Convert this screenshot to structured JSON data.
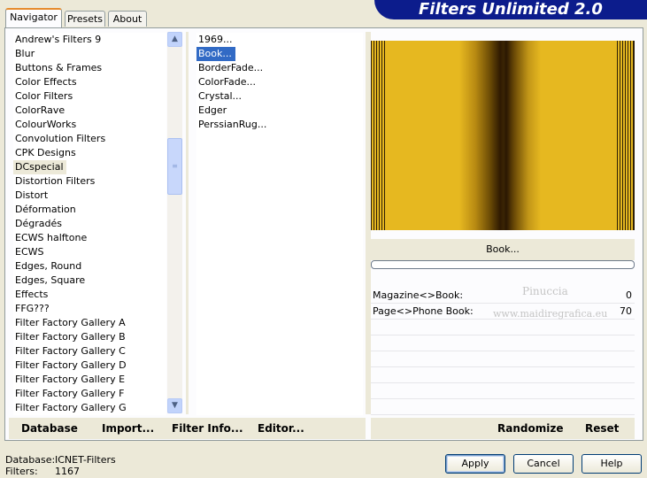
{
  "tabs": [
    {
      "label": "Navigator",
      "active": true
    },
    {
      "label": "Presets",
      "active": false
    },
    {
      "label": "About",
      "active": false
    }
  ],
  "title": "Filters Unlimited 2.0",
  "categories": [
    "Andrew's Filters 9",
    "Blur",
    "Buttons & Frames",
    "Color Effects",
    "Color Filters",
    "ColorRave",
    "ColourWorks",
    "Convolution Filters",
    "CPK Designs",
    "DCspecial",
    "Distortion Filters",
    "Distort",
    "Déformation",
    "Dégradés",
    "ECWS halftone",
    "ECWS",
    "Edges, Round",
    "Edges, Square",
    "Effects",
    "FFG???",
    "Filter Factory Gallery A",
    "Filter Factory Gallery B",
    "Filter Factory Gallery C",
    "Filter Factory Gallery D",
    "Filter Factory Gallery E",
    "Filter Factory Gallery F",
    "Filter Factory Gallery G"
  ],
  "selected_category_index": 9,
  "filters": [
    "1969...",
    "Book...",
    "BorderFade...",
    "ColorFade...",
    "Crystal...",
    "Edger",
    "PerssianRug..."
  ],
  "selected_filter_index": 1,
  "preview": {
    "filter_name": "Book...",
    "colors": {
      "gold": "#e6b820",
      "dark": "#2d1f05"
    }
  },
  "params": [
    {
      "label": "Magazine<>Book:",
      "value": "0"
    },
    {
      "label": "Page<>Phone Book:",
      "value": "70"
    }
  ],
  "watermark": {
    "line1": "Pinuccia",
    "line2": "www.maidiregrafica.eu"
  },
  "buttons": {
    "database": "Database",
    "import": "Import...",
    "filter_info": "Filter Info...",
    "editor": "Editor...",
    "randomize": "Randomize",
    "reset": "Reset",
    "apply": "Apply",
    "cancel": "Cancel",
    "help": "Help"
  },
  "status": {
    "database_label": "Database:",
    "database_value": "ICNET-Filters",
    "filters_label": "Filters:",
    "filters_value": "1167"
  },
  "icons": {
    "scroll_up": "chevron-up-icon",
    "scroll_down": "chevron-down-icon",
    "grip": "scroll-grip-icon"
  }
}
